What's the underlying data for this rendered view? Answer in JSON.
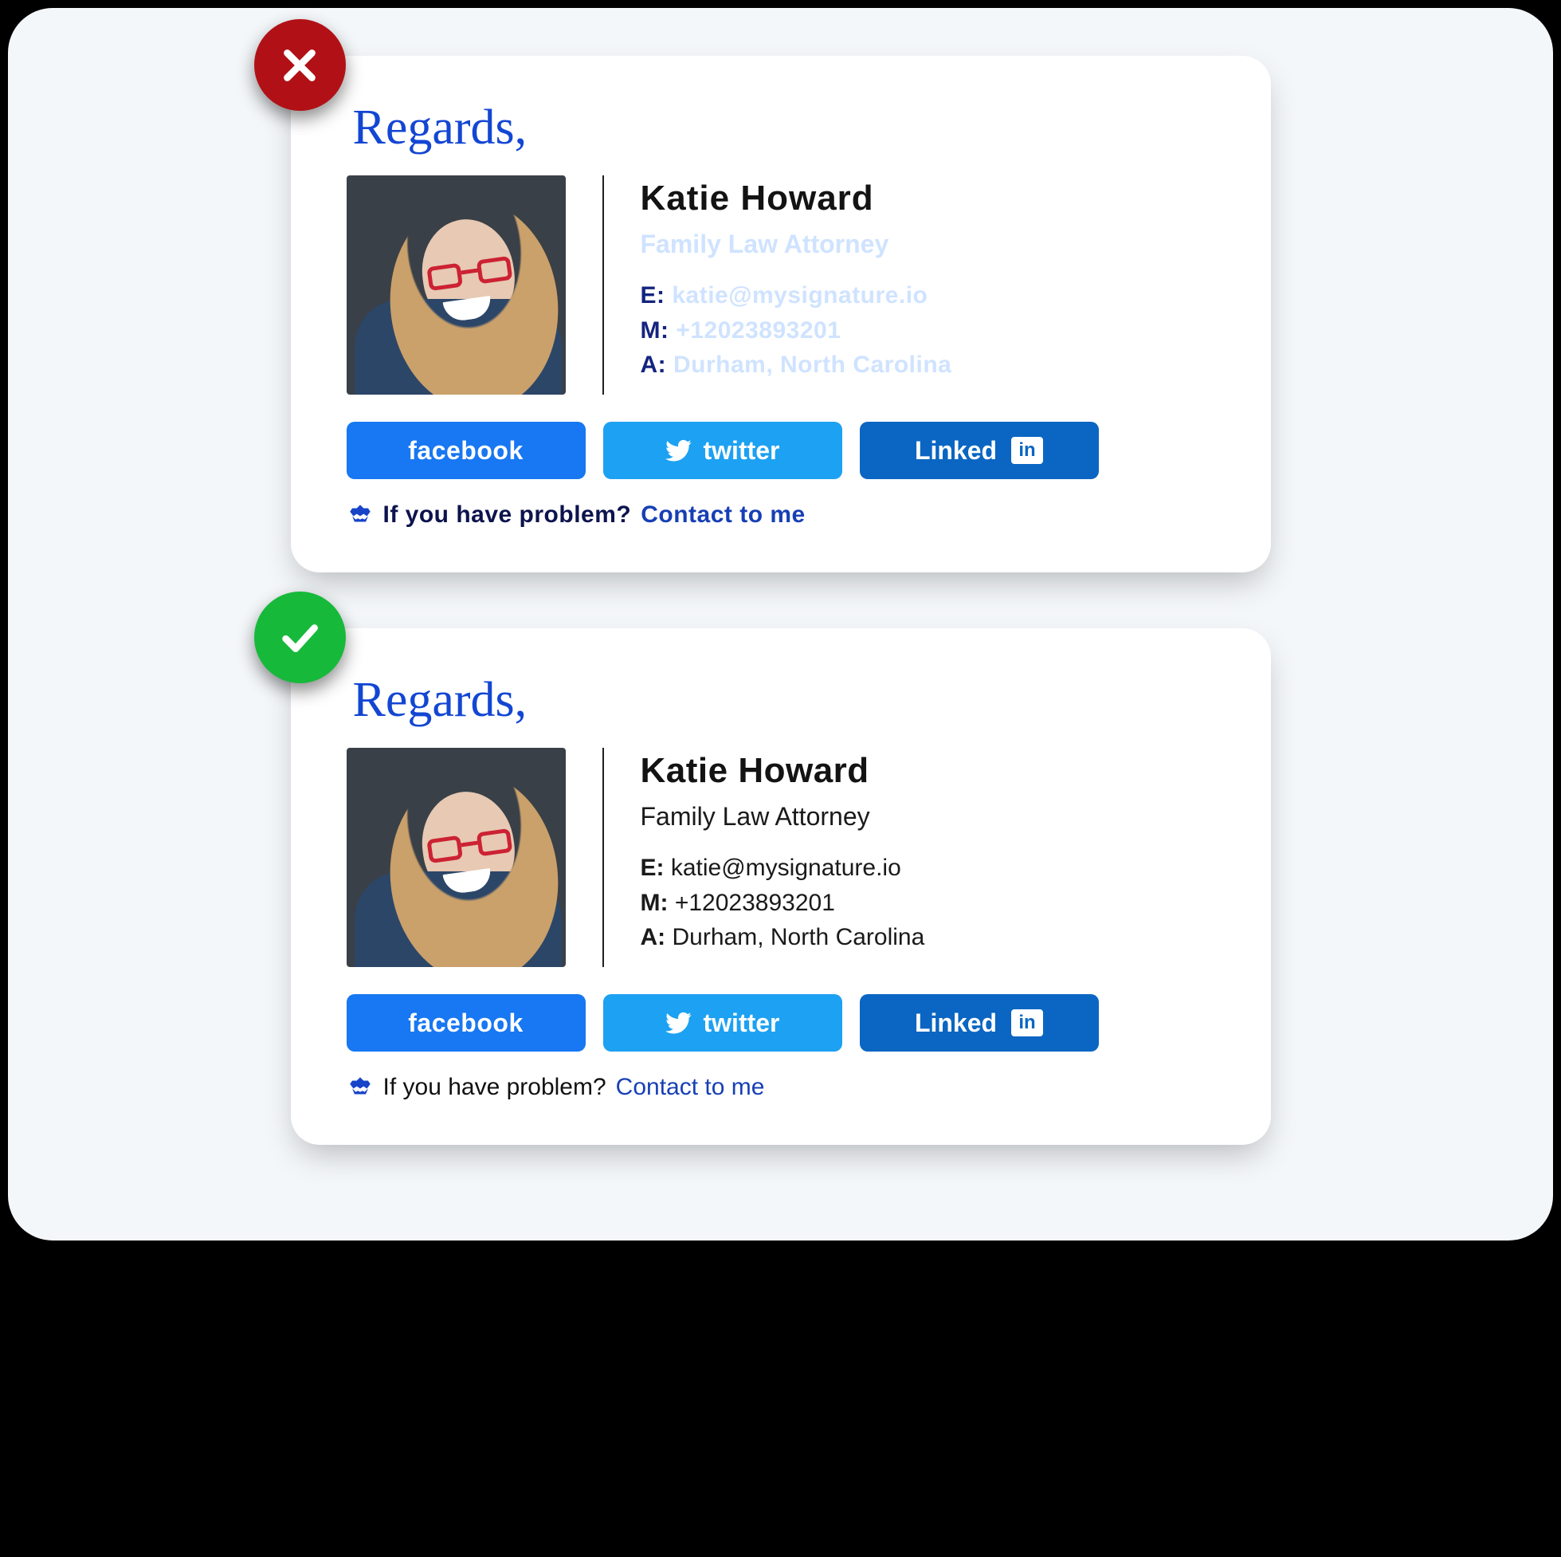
{
  "salutation": "Regards,",
  "person": {
    "name": "Katie Howard",
    "role": "Family Law Attorney",
    "email_key": "E:",
    "email": "katie@mysignature.io",
    "phone_key": "M:",
    "phone": "+12023893201",
    "address_key": "A:",
    "address": "Durham, North Carolina"
  },
  "social": {
    "facebook": "facebook",
    "twitter": "twitter",
    "linkedin": "Linked",
    "linkedin_box": "in"
  },
  "cta": {
    "question": "If you have problem?",
    "link": "Contact to me"
  },
  "badge": {
    "bad": "incorrect-example",
    "good": "correct-example"
  }
}
